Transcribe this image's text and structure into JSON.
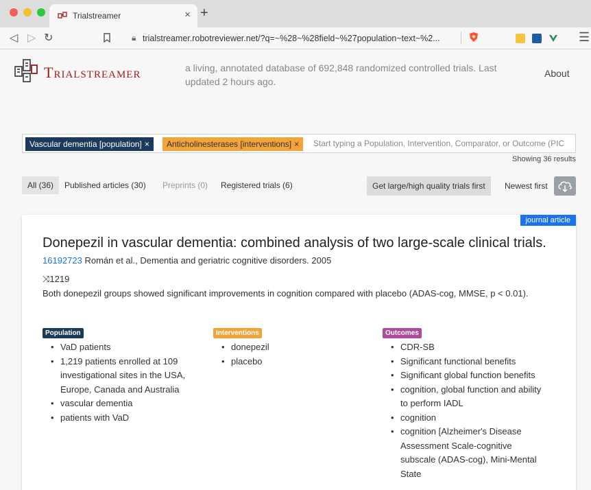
{
  "browser": {
    "tab_title": "Trialstreamer",
    "tab_close": "×",
    "new_tab": "+",
    "url": "trialstreamer.robotreviewer.net/?q=~%28~%28field~%27population~text~%2..."
  },
  "header": {
    "logo_text": "Trialstreamer",
    "tagline": "a living, annotated database of 692,848 randomized controlled trials. Last updated 2 hours ago.",
    "about": "About"
  },
  "search": {
    "chips": [
      {
        "label": "Vascular dementia [population]",
        "remove": "×"
      },
      {
        "label": "Anticholinesterases [interventions]",
        "remove": "×"
      }
    ],
    "placeholder": "Start typing a Population, Intervention, Comparator, or Outcome (PIC",
    "results_text": "Showing 36 results"
  },
  "filters": [
    {
      "label": "All (36)"
    },
    {
      "label": "Published articles (30)"
    },
    {
      "label": "Preprints (0)"
    },
    {
      "label": "Registered trials (6)"
    }
  ],
  "sort": {
    "quality_label": "Get large/high quality trials first",
    "newest_label": "Newest first"
  },
  "article": {
    "type_badge": "journal article",
    "title": "Donepezil in vascular dementia: combined analysis of two large-scale clinical trials.",
    "pmid": "16192723",
    "citation": " Román et al., Dementia and geriatric cognitive disorders. 2005",
    "participants": "⤨1219",
    "summary": "Both donepezil groups showed significant improvements in cognition compared with placebo (ADAS-cog, MMSE, p < 0.01).",
    "population": {
      "label": "Population",
      "items": [
        "VaD patients",
        "1,219 patients enrolled at 109 investigational sites in the USA, Europe, Canada and Australia",
        "vascular dementia",
        "patients with VaD"
      ]
    },
    "interventions": {
      "label": "Interventions",
      "items": [
        "donepezil",
        "placebo"
      ]
    },
    "outcomes": {
      "label": "Outcomes",
      "items": [
        "CDR-SB",
        "Significant functional benefits",
        "Significant global function benefits",
        "cognition, global function and ability to perform IADL",
        "cognition",
        "cognition [Alzheimer's Disease Assessment Scale-cognitive subscale (ADAS-cog), Mini-Mental State"
      ]
    }
  },
  "colors": {
    "brand_red": "#a11a1a",
    "population": "#1c3a5a",
    "interventions": "#f2a33a",
    "outcomes": "#b04a9d",
    "link_blue": "#1a73e8"
  }
}
